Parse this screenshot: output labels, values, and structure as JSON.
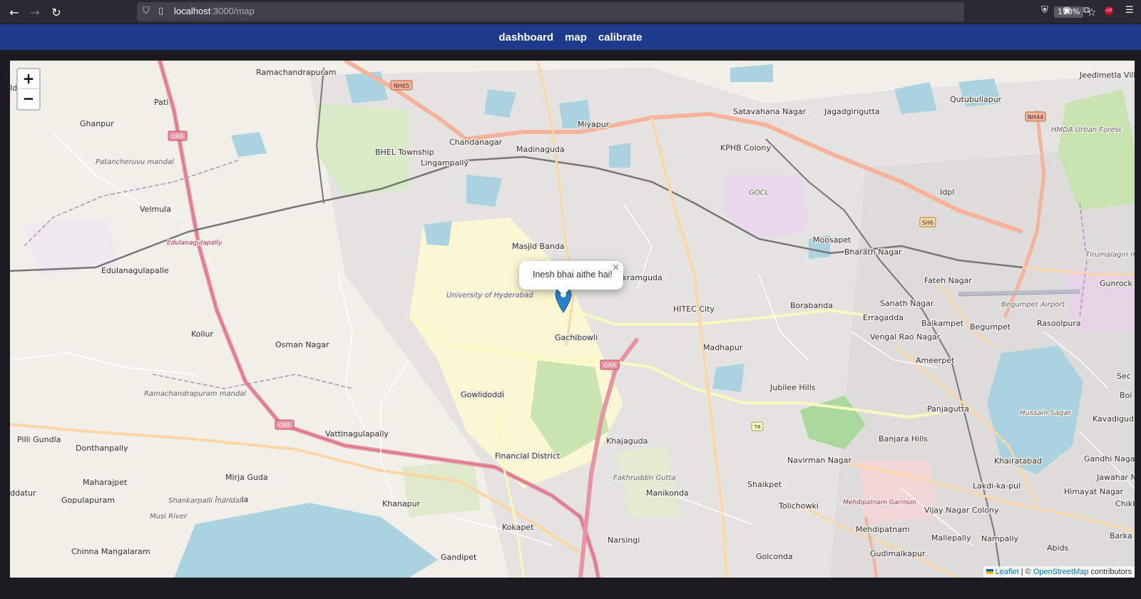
{
  "browser": {
    "url_host": "localhost",
    "url_path": ":3000/map",
    "zoom": "110%"
  },
  "nav": {
    "links": [
      "dashboard",
      "map",
      "calibrate"
    ]
  },
  "map": {
    "zoom_in": "+",
    "zoom_out": "−",
    "popup_text": "Inesh bhai aithe hai!",
    "popup_close": "×",
    "attribution": {
      "leaflet": "Leaflet",
      "separator": " | © ",
      "osm": "OpenStreetMap",
      "suffix": " contributors"
    },
    "labels": [
      "Ramachandrapuram",
      "Pati",
      "Ghanpur",
      "Patancheruvu mandal",
      "Velmula",
      "Edulanagulapally",
      "Edulanagulapalle",
      "Kollur",
      "Osman Nagar",
      "Ramachandrapuram mandal",
      "Pilli Gundla",
      "Donthanpally",
      "Maharajpet",
      "Gopulapuram",
      "Mirja Guda",
      "Janwada",
      "Chinna Mangalaram",
      "Vattinagulapally",
      "Khanapur",
      "Kokapet",
      "Gandipet",
      "Narsingi",
      "Financial District",
      "Gowlidoddi",
      "Khajaguda",
      "Manikonda",
      "Fakhruddin Gutta",
      "University of Hyderabad",
      "Gachibowli",
      "Masjid Banda",
      "Nanakramguda",
      "HITEC City",
      "Madhapur",
      "Jubilee Hills",
      "Borabanda",
      "Miyapur",
      "Chandanagar",
      "BHEL Township",
      "Lingampally",
      "Madinaguda",
      "Satavahana Nagar",
      "KPHB Colony",
      "Jagadgirigutta",
      "GOCL",
      "Moosapet",
      "Bharath Nagar",
      "Idpl",
      "Qutubullapur",
      "Jeedimetla Village",
      "Fateh Nagar",
      "Sanath Nagar",
      "Balkampet",
      "Begumpet",
      "Rasoolpura",
      "Erragadda",
      "Vengal Rao Nagar",
      "Ameerpet",
      "Panjagutta",
      "Hussain Sagar",
      "Banjara Hills",
      "Navirman Nagar",
      "Khairatabad",
      "Gandhi Nagar",
      "Lakdi-ka-pul",
      "Himayat Nagar",
      "Vijay Nagar Colony",
      "Mehdipatnam",
      "Mehdipatnam Garrison",
      "Tolichowki",
      "Shaikpet",
      "Golconda",
      "Mallepally",
      "Nampally",
      "Gudimalkapur",
      "Abids",
      "Kavadiguda",
      "Tirumalagiri mandal",
      "Begumpet Airport",
      "HMDA Urban Forest",
      "Gunrock",
      "Sec",
      "Boi",
      "Jawahar Na",
      "Barka",
      "Chikk",
      "ddatur",
      "Idi",
      "Shankarpalli mandal",
      "Musi River"
    ]
  }
}
